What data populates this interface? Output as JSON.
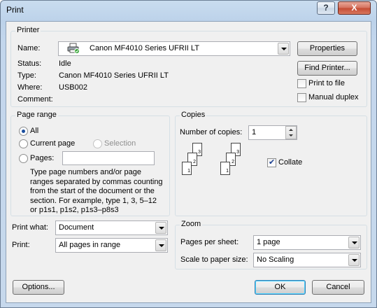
{
  "window": {
    "title": "Print",
    "help_label": "?",
    "close_label": "X"
  },
  "printer": {
    "group_label": "Printer",
    "name_label": "Name:",
    "name_value": "Canon MF4010 Series UFRII LT",
    "status_label": "Status:",
    "status_value": "Idle",
    "type_label": "Type:",
    "type_value": "Canon MF4010 Series UFRII LT",
    "where_label": "Where:",
    "where_value": "USB002",
    "comment_label": "Comment:",
    "comment_value": "",
    "properties_label": "Properties",
    "find_printer_label": "Find Printer...",
    "print_to_file_label": "Print to file",
    "print_to_file_checked": false,
    "manual_duplex_label": "Manual duplex",
    "manual_duplex_checked": false
  },
  "page_range": {
    "group_label": "Page range",
    "all_label": "All",
    "current_page_label": "Current page",
    "selection_label": "Selection",
    "pages_label": "Pages:",
    "pages_value": "",
    "selected": "All",
    "help_lines": [
      "Type page numbers and/or page",
      "ranges separated by commas counting",
      "from the start of the document or the",
      "section. For example, type 1, 3, 5–12",
      "or p1s1, p1s2, p1s3–p8s3"
    ]
  },
  "copies": {
    "group_label": "Copies",
    "number_label": "Number of copies:",
    "number_value": "1",
    "collate_label": "Collate",
    "collate_checked": true,
    "stack_pages": [
      "1",
      "2",
      "3"
    ]
  },
  "print_what": {
    "label": "Print what:",
    "value": "Document"
  },
  "print": {
    "label": "Print:",
    "value": "All pages in range"
  },
  "zoom": {
    "group_label": "Zoom",
    "pages_per_sheet_label": "Pages per sheet:",
    "pages_per_sheet_value": "1 page",
    "scale_label": "Scale to paper size:",
    "scale_value": "No Scaling"
  },
  "buttons": {
    "options": "Options...",
    "ok": "OK",
    "cancel": "Cancel"
  },
  "colors": {
    "title_bar": "#c3d6ec",
    "dialog_bg": "#f0f0f0",
    "close_button": "#c44a33"
  }
}
